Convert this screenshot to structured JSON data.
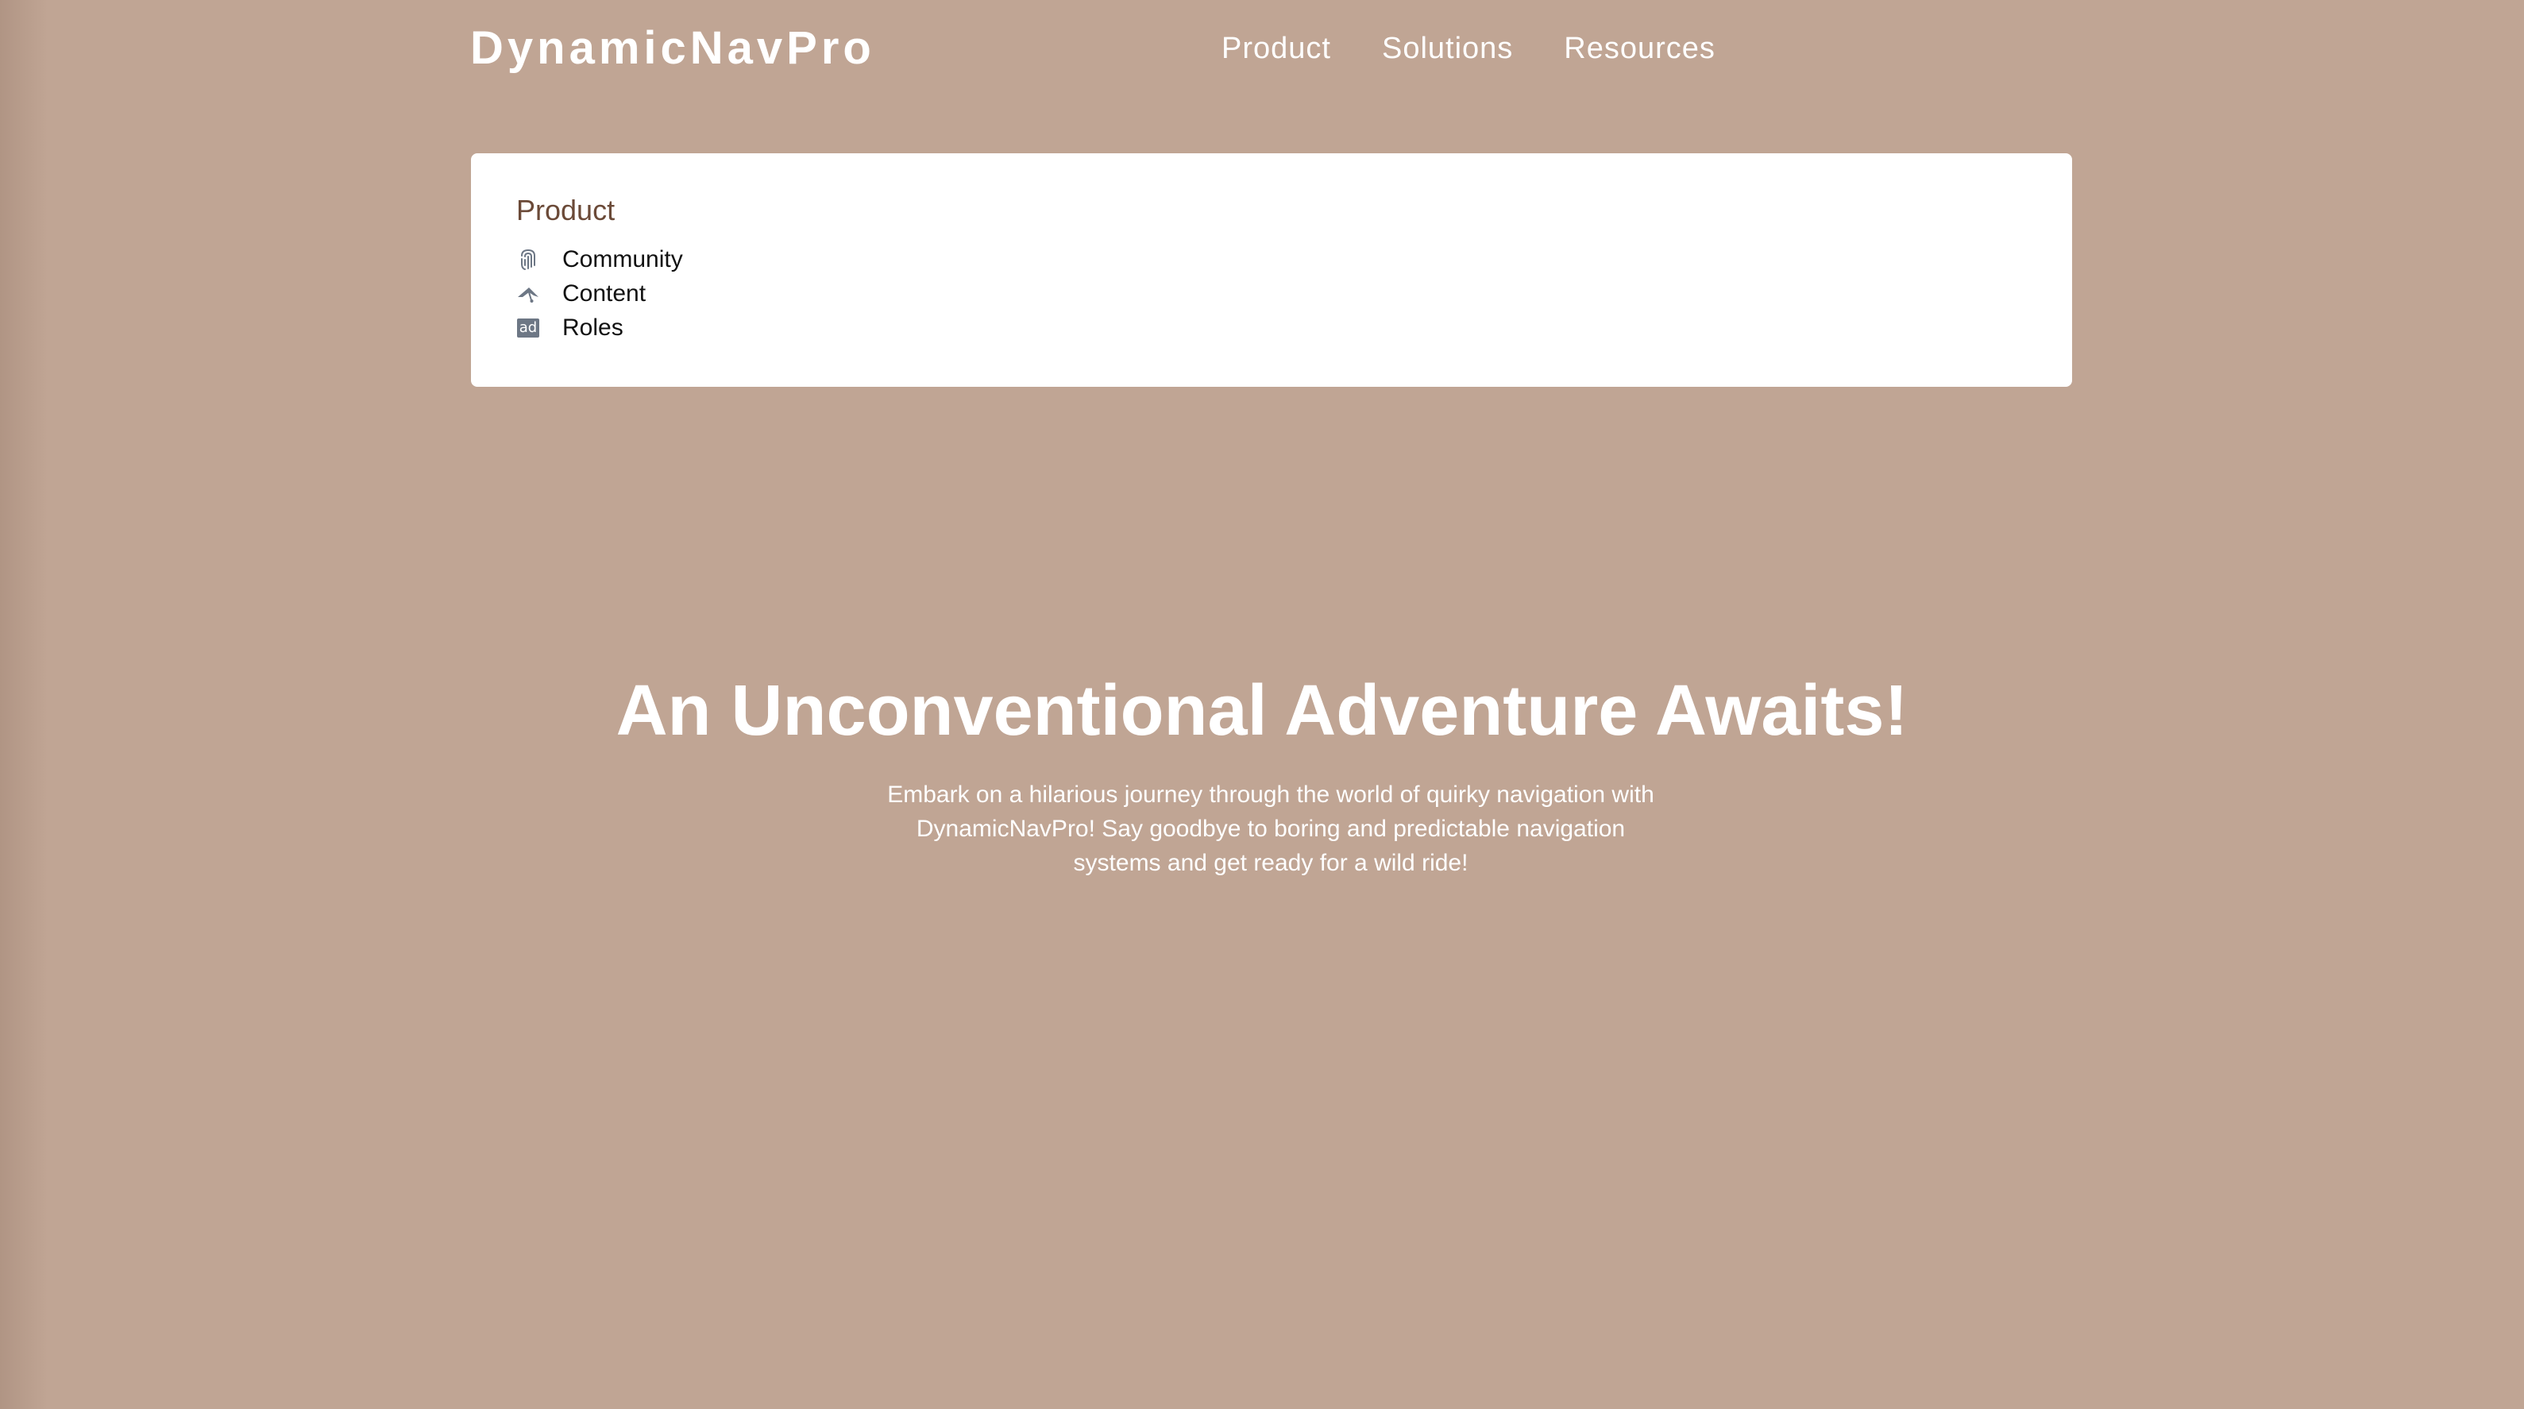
{
  "header": {
    "logo": "DynamicNavPro",
    "nav": [
      "Product",
      "Solutions",
      "Resources"
    ]
  },
  "dropdown": {
    "heading": "Product",
    "items": [
      {
        "label": "Community",
        "icon": "fingerprint-icon"
      },
      {
        "label": "Content",
        "icon": "hang-glider-icon"
      },
      {
        "label": "Roles",
        "icon": "ad-icon",
        "icon_text": "ad"
      }
    ]
  },
  "hero": {
    "title": "An Unconventional Adventure Awaits!",
    "subtitle": "Embark on a hilarious journey through the world of quirky navigation with DynamicNavPro! Say goodbye to boring and predictable navigation systems and get ready for a wild ride!"
  },
  "colors": {
    "background": "#c0a594",
    "panel": "#ffffff",
    "heading_accent": "#6b4a38",
    "icon": "#6d7785"
  }
}
